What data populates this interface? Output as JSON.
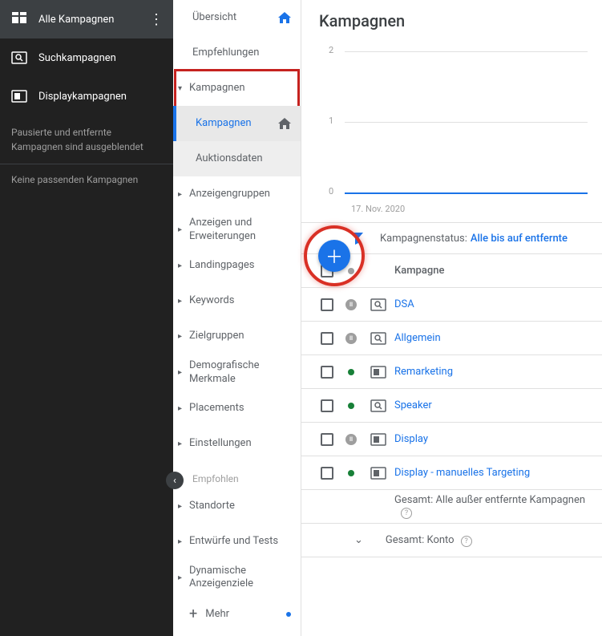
{
  "dark_sidebar": {
    "top": "Alle Kampagnen",
    "items": [
      "Suchkampagnen",
      "Displaykampagnen"
    ],
    "note": "Pausierte und entfernte Kampagnen sind ausgeblendet",
    "none": "Keine passenden Kampagnen"
  },
  "light_sidebar": {
    "overview": "Übersicht",
    "recommendations": "Empfehlungen",
    "campaigns_group": "Kampagnen",
    "campaigns": "Kampagnen",
    "auction": "Auktionsdaten",
    "items": [
      "Anzeigengruppen",
      "Anzeigen und Erweiterungen",
      "Landingpages",
      "Keywords",
      "Zielgruppen",
      "Demografische Merkmale",
      "Placements",
      "Einstellungen"
    ],
    "recommended": "Empfohlen",
    "rec_items": [
      "Standorte",
      "Entwürfe und Tests",
      "Dynamische Anzeigenziele"
    ],
    "more": "Mehr"
  },
  "main": {
    "title": "Kampagnen",
    "filter_label": "Kampagnenstatus:",
    "filter_value": "Alle bis auf entfernte",
    "header": "Kampagne",
    "rows": [
      {
        "status": "paused",
        "type": "search",
        "name": "DSA"
      },
      {
        "status": "paused",
        "type": "search",
        "name": "Allgemein"
      },
      {
        "status": "active",
        "type": "display",
        "name": "Remarketing"
      },
      {
        "status": "active",
        "type": "search",
        "name": "Speaker"
      },
      {
        "status": "paused",
        "type": "display",
        "name": "Display"
      },
      {
        "status": "active",
        "type": "display",
        "name": "Display - manuelles Targeting"
      }
    ],
    "summary1": "Gesamt: Alle außer entfernte Kampagnen",
    "summary2": "Gesamt: Konto"
  },
  "chart_data": {
    "type": "line",
    "title": "",
    "xlabel": "",
    "ylabel": "",
    "ylim": [
      0,
      2
    ],
    "yticks": [
      0,
      1,
      2
    ],
    "x": [
      "17. Nov. 2020"
    ],
    "series": [
      {
        "name": "",
        "values": [
          0
        ]
      }
    ]
  }
}
